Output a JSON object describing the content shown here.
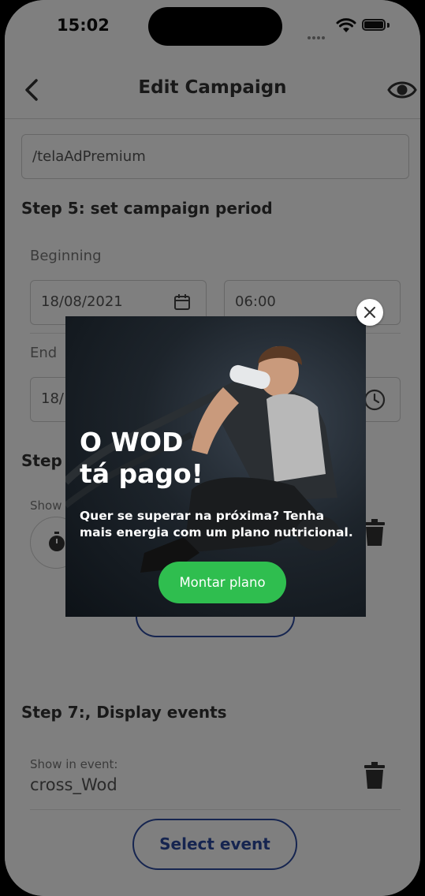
{
  "status_bar": {
    "time": "15:02"
  },
  "header": {
    "title": "Edit Campaign",
    "back_icon": "chevron-left-icon",
    "preview_icon": "eye-icon"
  },
  "url_field": {
    "value": "/telaAdPremium"
  },
  "step5": {
    "title": "Step 5: set campaign period",
    "beginning_label": "Beginning",
    "beginning_date": "18/08/2021",
    "beginning_time": "06:00",
    "end_label": "End",
    "end_date": "18/"
  },
  "step6": {
    "title": "Step 6",
    "show_label": "Show"
  },
  "step7": {
    "title": "Step 7:, Display events",
    "show_in_event_label": "Show in event:",
    "event_value": "cross_Wod",
    "select_button": "Select event"
  },
  "modal": {
    "title": "O WOD\ntá pago!",
    "subtitle": "Quer se superar na próxima? Tenha mais energia com um plano nutricional.",
    "cta": "Montar plano",
    "cta_color": "#2fbe4f"
  },
  "colors": {
    "accent": "#2c4aa0",
    "overlay": "rgba(0,0,0,0.5)"
  }
}
